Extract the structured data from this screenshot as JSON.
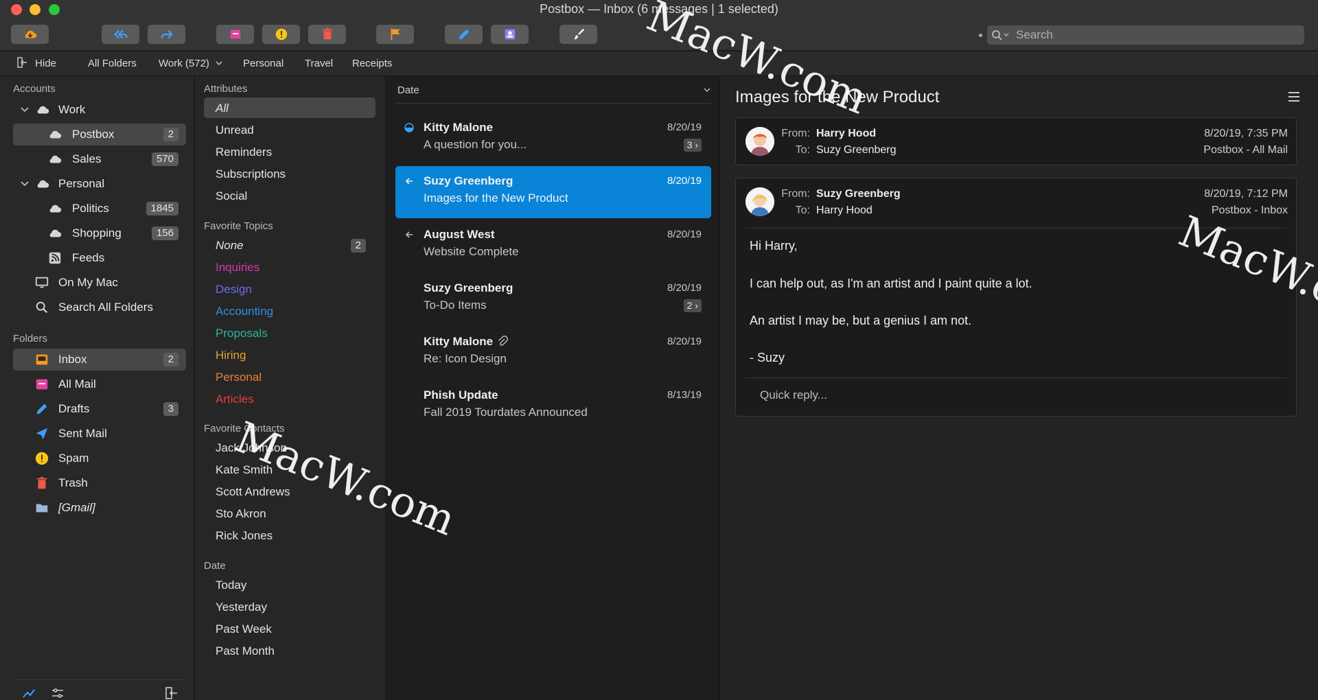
{
  "window": {
    "title": "Postbox — Inbox (6 messages | 1 selected)"
  },
  "search": {
    "placeholder": "Search"
  },
  "favbar": {
    "hide": "Hide",
    "items": [
      "All Folders",
      "Work (572)",
      "Personal",
      "Travel",
      "Receipts"
    ]
  },
  "sidebar": {
    "accounts_heading": "Accounts",
    "accounts": [
      {
        "label": "Work",
        "badge": ""
      },
      {
        "label": "Postbox",
        "badge": "2"
      },
      {
        "label": "Sales",
        "badge": "570"
      },
      {
        "label": "Personal",
        "badge": ""
      },
      {
        "label": "Politics",
        "badge": "1845"
      },
      {
        "label": "Shopping",
        "badge": "156"
      },
      {
        "label": "Feeds",
        "badge": ""
      },
      {
        "label": "On My Mac",
        "badge": ""
      },
      {
        "label": "Search All Folders",
        "badge": ""
      }
    ],
    "folders_heading": "Folders",
    "folders": [
      {
        "label": "Inbox",
        "badge": "2"
      },
      {
        "label": "All Mail",
        "badge": ""
      },
      {
        "label": "Drafts",
        "badge": "3"
      },
      {
        "label": "Sent Mail",
        "badge": ""
      },
      {
        "label": "Spam",
        "badge": ""
      },
      {
        "label": "Trash",
        "badge": ""
      },
      {
        "label": "[Gmail]",
        "badge": ""
      }
    ]
  },
  "filters": {
    "attributes_heading": "Attributes",
    "attributes": [
      "All",
      "Unread",
      "Reminders",
      "Subscriptions",
      "Social"
    ],
    "topics_heading": "Favorite Topics",
    "topics": [
      {
        "label": "None",
        "color": "#e4e4e4",
        "badge": "2"
      },
      {
        "label": "Inquiries",
        "color": "#d63aa8",
        "badge": ""
      },
      {
        "label": "Design",
        "color": "#6f6ef0",
        "badge": ""
      },
      {
        "label": "Accounting",
        "color": "#2f8fe0",
        "badge": ""
      },
      {
        "label": "Proposals",
        "color": "#2fb39a",
        "badge": ""
      },
      {
        "label": "Hiring",
        "color": "#e2a52c",
        "badge": ""
      },
      {
        "label": "Personal",
        "color": "#ee7f3a",
        "badge": ""
      },
      {
        "label": "Articles",
        "color": "#e43b3b",
        "badge": ""
      }
    ],
    "contacts_heading": "Favorite Contacts",
    "contacts": [
      "Jack Johnson",
      "Kate Smith",
      "Scott Andrews",
      "Sto Akron",
      "Rick Jones"
    ],
    "date_heading": "Date",
    "dates": [
      "Today",
      "Yesterday",
      "Past Week",
      "Past Month"
    ]
  },
  "message_list": {
    "sort_label": "Date",
    "messages": [
      {
        "from": "Kitty Malone",
        "subject": "A question for you...",
        "date": "8/20/19",
        "thread": "3 ›",
        "status": "unread"
      },
      {
        "from": "Suzy Greenberg",
        "subject": "Images for the New Product",
        "date": "8/20/19",
        "thread": "",
        "status": "replied"
      },
      {
        "from": "August West",
        "subject": "Website Complete",
        "date": "8/20/19",
        "thread": "",
        "status": "replied"
      },
      {
        "from": "Suzy Greenberg",
        "subject": "To-Do Items",
        "date": "8/20/19",
        "thread": "2 ›",
        "status": ""
      },
      {
        "from": "Kitty Malone",
        "subject": "Re: Icon Design",
        "date": "8/20/19",
        "thread": "",
        "status": "attachment"
      },
      {
        "from": "Phish Update",
        "subject": "Fall 2019 Tourdates Announced",
        "date": "8/13/19",
        "thread": "",
        "status": ""
      }
    ]
  },
  "reading": {
    "title": "Images for the New Product",
    "from_key": "From:",
    "to_key": "To:",
    "messages": [
      {
        "from": "Harry Hood",
        "to": "Suzy Greenberg",
        "date": "8/20/19, 7:35 PM",
        "folder": "Postbox - All Mail"
      },
      {
        "from": "Suzy Greenberg",
        "to": "Harry Hood",
        "date": "8/20/19, 7:12 PM",
        "folder": "Postbox - Inbox"
      }
    ],
    "body": [
      "Hi Harry,",
      "I can help out, as I'm an artist and I paint quite a lot.",
      "An artist I may be, but a genius I am not.",
      "- Suzy"
    ],
    "quick_reply_placeholder": "Quick reply..."
  },
  "watermark": {
    "text": "MacW.com"
  },
  "colors": {
    "accent": "#0a84d6",
    "toolbar": "#333333",
    "selection": "#474747"
  }
}
